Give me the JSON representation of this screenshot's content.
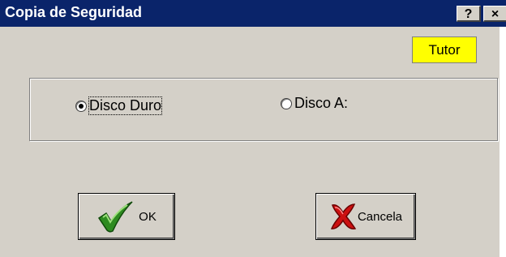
{
  "window": {
    "title": "Copia de Seguridad",
    "help_label": "?",
    "close_label": "×"
  },
  "tutor_label": "Tutor",
  "options": [
    {
      "label": "Disco Duro",
      "checked": true
    },
    {
      "label": "Disco A:",
      "checked": false
    }
  ],
  "buttons": {
    "ok_label": "OK",
    "cancel_label": "Cancela"
  },
  "colors": {
    "titlebar": "#0a246a",
    "tutor_bg": "#ffff00",
    "ok_check": "#2e8b20",
    "cancel_x": "#cc1010"
  },
  "icons": {
    "ok": "checkmark-icon",
    "cancel": "red-x-icon"
  }
}
